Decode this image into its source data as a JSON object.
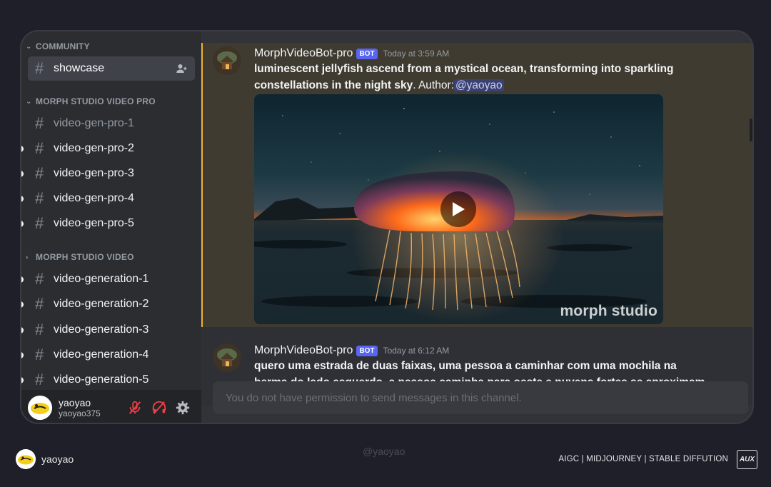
{
  "sidebar": {
    "categories": [
      {
        "label": "COMMUNITY",
        "chevron": "chevron-down-icon"
      },
      {
        "label": "MORPH STUDIO VIDEO PRO",
        "chevron": "chevron-down-icon"
      },
      {
        "label": "MORPH STUDIO VIDEO",
        "chevron": "chevron-right-icon"
      }
    ],
    "channels": [
      {
        "label": "showcase",
        "selected": true
      },
      {
        "label": "video-gen-pro-1",
        "unread": false
      },
      {
        "label": "video-gen-pro-2",
        "unread": true
      },
      {
        "label": "video-gen-pro-3",
        "unread": true
      },
      {
        "label": "video-gen-pro-4",
        "unread": true
      },
      {
        "label": "video-gen-pro-5",
        "unread": true
      },
      {
        "label": "video-generation-1",
        "unread": true
      },
      {
        "label": "video-generation-2",
        "unread": true
      },
      {
        "label": "video-generation-3",
        "unread": true
      },
      {
        "label": "video-generation-4",
        "unread": true
      },
      {
        "label": "video-generation-5",
        "unread": true
      }
    ]
  },
  "user_panel": {
    "display_name": "yaoyao",
    "username": "yaoyao375",
    "icons": [
      "mic-muted-icon",
      "headphones-deafened-icon",
      "gear-icon"
    ]
  },
  "messages": [
    {
      "author": "MorphVideoBot-pro",
      "badge": "BOT",
      "time": "Today at 3:59 AM",
      "prompt": "luminescent jellyfish ascend from a mystical ocean, transforming into sparkling constellations in the night sky",
      "suffix": ". Author:",
      "mention": "@yaoyao",
      "video_watermark": "morph studio"
    },
    {
      "author": "MorphVideoBot-pro",
      "badge": "BOT",
      "time": "Today at 6:12 AM",
      "prompt": "quero uma estrada de duas faixas, uma pessoa a caminhar com uma mochila na berma do lado esquerdo, a pessoa caminha para oeste e nuvens fortes se aproximam do oeste"
    }
  ],
  "composer": {
    "placeholder": "You do not have permission to send messages in this channel."
  },
  "footer": {
    "name": "yaoyao",
    "credit": "@yaoyao",
    "tags": "AIGC | MIDJOURNEY | STABLE DIFFUTION",
    "logo": "AUX"
  },
  "colors": {
    "background": "#1e1f29",
    "highlight_bar": "#f0b232",
    "bot_badge": "#5865f2",
    "mention": "#3c4270"
  }
}
